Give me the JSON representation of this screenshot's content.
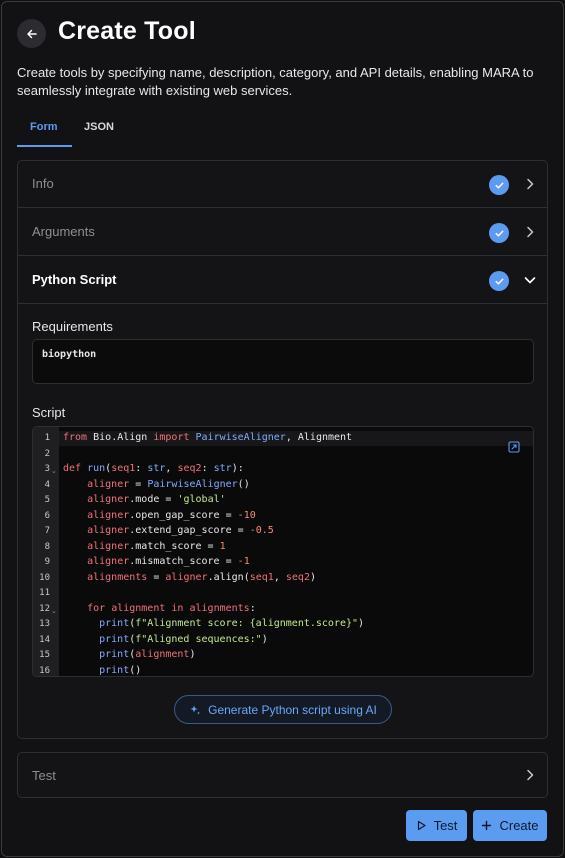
{
  "header": {
    "title": "Create Tool",
    "description": "Create tools by specifying name, description, category, and API details, enabling MARA to seamlessly integrate with existing web services."
  },
  "tabs": [
    {
      "label": "Form",
      "active": true
    },
    {
      "label": "JSON",
      "active": false
    }
  ],
  "sections": {
    "info": {
      "title": "Info",
      "complete": true
    },
    "arguments": {
      "title": "Arguments",
      "complete": true
    },
    "python_script": {
      "title": "Python Script",
      "complete": true,
      "expanded": true
    },
    "test": {
      "title": "Test"
    }
  },
  "python_script": {
    "requirements_label": "Requirements",
    "requirements_value": "biopython",
    "script_label": "Script",
    "line_numbers": [
      "1",
      "2",
      "3",
      "4",
      "5",
      "6",
      "7",
      "8",
      "9",
      "10",
      "11",
      "12",
      "13",
      "14",
      "15",
      "16"
    ],
    "code_lines": [
      "from Bio.Align import PairwiseAligner, Alignment",
      "",
      "def run(seq1: str, seq2: str):",
      "    aligner = PairwiseAligner()",
      "    aligner.mode = 'global'",
      "    aligner.open_gap_score = -10",
      "    aligner.extend_gap_score = -0.5",
      "    aligner.match_score = 1",
      "    aligner.mismatch_score = -1",
      "    alignments = aligner.align(seq1, seq2)",
      "",
      "    for alignment in alignments:",
      "      print(f\"Alignment score: {alignment.score}\")",
      "      print(f\"Aligned sequences:\")",
      "      print(alignment)",
      "      print()"
    ],
    "ai_button_label": "Generate Python script using AI"
  },
  "actions": {
    "test_label": "Test",
    "create_label": "Create"
  },
  "colors": {
    "accent": "#5b9bf0",
    "background": "#121214",
    "border": "#2f2f33"
  },
  "icons": {
    "back": "arrow-left-icon",
    "check": "check-circle-icon",
    "chevron_right": "chevron-right-icon",
    "chevron_down": "chevron-down-icon",
    "expand": "expand-icon",
    "sparkle": "sparkle-icon",
    "play": "play-icon",
    "plus": "plus-icon"
  }
}
